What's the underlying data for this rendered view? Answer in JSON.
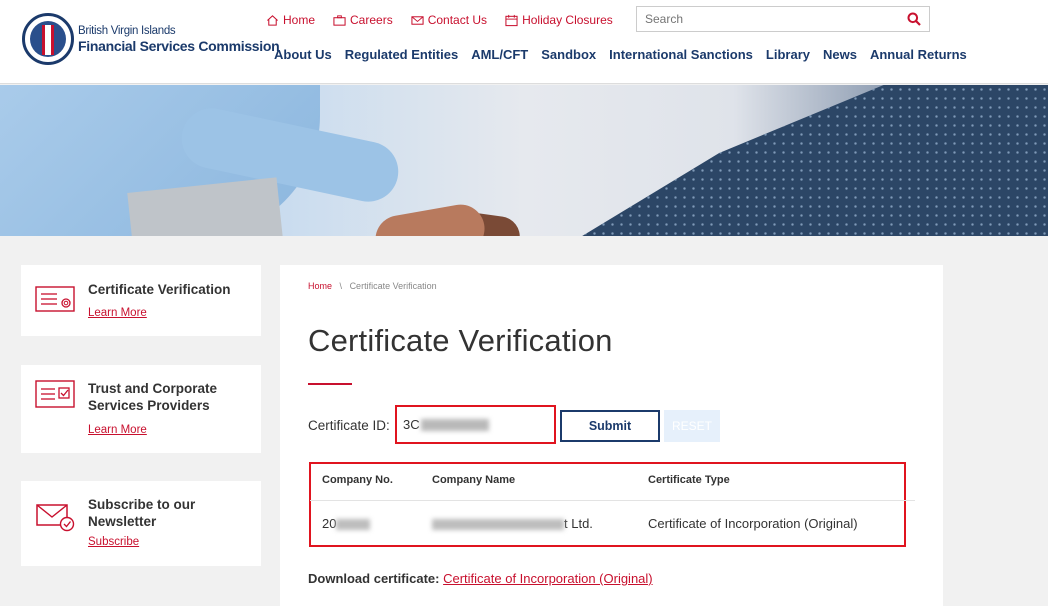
{
  "brand": {
    "line1": "British Virgin Islands",
    "line2": "Financial Services Commission"
  },
  "utility_nav": [
    {
      "label": "Home",
      "icon": "home-icon"
    },
    {
      "label": "Careers",
      "icon": "briefcase-icon"
    },
    {
      "label": "Contact Us",
      "icon": "envelope-icon"
    },
    {
      "label": "Holiday Closures",
      "icon": "calendar-icon"
    }
  ],
  "search": {
    "placeholder": "Search"
  },
  "main_nav": [
    "About Us",
    "Regulated Entities",
    "AML/CFT",
    "Sandbox",
    "International Sanctions",
    "Library",
    "News",
    "Annual Returns"
  ],
  "sidebar": [
    {
      "title": "Certificate Verification",
      "link": "Learn More",
      "icon": "certificate-icon"
    },
    {
      "title": "Trust and Corporate Services Providers",
      "link": "Learn More",
      "icon": "checklist-icon"
    },
    {
      "title": "Subscribe to our Newsletter",
      "link": "Subscribe",
      "icon": "mail-check-icon"
    }
  ],
  "breadcrumb": {
    "home": "Home",
    "separator": "\\",
    "current": "Certificate Verification"
  },
  "page_title": "Certificate Verification",
  "form": {
    "label": "Certificate ID:",
    "value": "3C",
    "submit": "Submit",
    "reset": "RESET"
  },
  "results": {
    "headers": [
      "Company No.",
      "Company Name",
      "Certificate Type"
    ],
    "row": {
      "company_no": "20",
      "company_name_suffix": "t Ltd.",
      "certificate_type": "Certificate of Incorporation (Original)"
    }
  },
  "download": {
    "label": "Download certificate:",
    "link": "Certificate of Incorporation (Original)"
  },
  "colors": {
    "brand_navy": "#1b3a6b",
    "accent_red": "#c8102e",
    "highlight_red": "#e0141f"
  }
}
